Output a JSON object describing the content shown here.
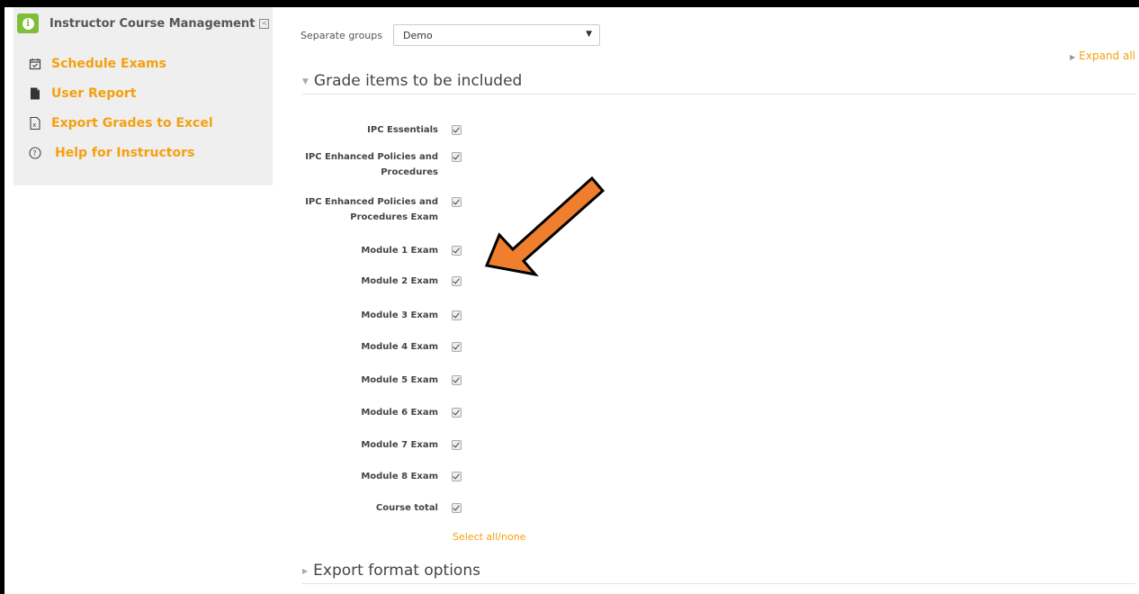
{
  "sidebar": {
    "title": "Instructor Course Management",
    "items": [
      {
        "label": "Schedule Exams",
        "icon": "calendar-check-icon"
      },
      {
        "label": "User Report",
        "icon": "file-icon"
      },
      {
        "label": "Export Grades to Excel",
        "icon": "excel-file-icon"
      },
      {
        "label": "Help for Instructors",
        "icon": "help-circle-icon"
      }
    ]
  },
  "main": {
    "group_label": "Separate groups",
    "group_value": "Demo",
    "expand_all": "Expand all",
    "section_grade_items": "Grade items to be included",
    "grade_items": [
      {
        "label": "IPC Essentials",
        "checked": true
      },
      {
        "label": "IPC Enhanced Policies and Procedures",
        "checked": true
      },
      {
        "label": "IPC Enhanced Policies and Procedures Exam",
        "checked": true
      },
      {
        "label": "Module 1 Exam",
        "checked": true
      },
      {
        "label": "Module 2 Exam",
        "checked": true
      },
      {
        "label": "Module 3 Exam",
        "checked": true
      },
      {
        "label": "Module 4 Exam",
        "checked": true
      },
      {
        "label": "Module 5 Exam",
        "checked": true
      },
      {
        "label": "Module 6 Exam",
        "checked": true
      },
      {
        "label": "Module 7 Exam",
        "checked": true
      },
      {
        "label": "Module 8 Exam",
        "checked": true
      },
      {
        "label": "Course total",
        "checked": true
      }
    ],
    "select_all": "Select all/none",
    "section_export_format": "Export format options"
  },
  "colors": {
    "accent": "#f4a00e",
    "info_green": "#7fbd3a",
    "arrow_fill": "#ef7f2f"
  }
}
